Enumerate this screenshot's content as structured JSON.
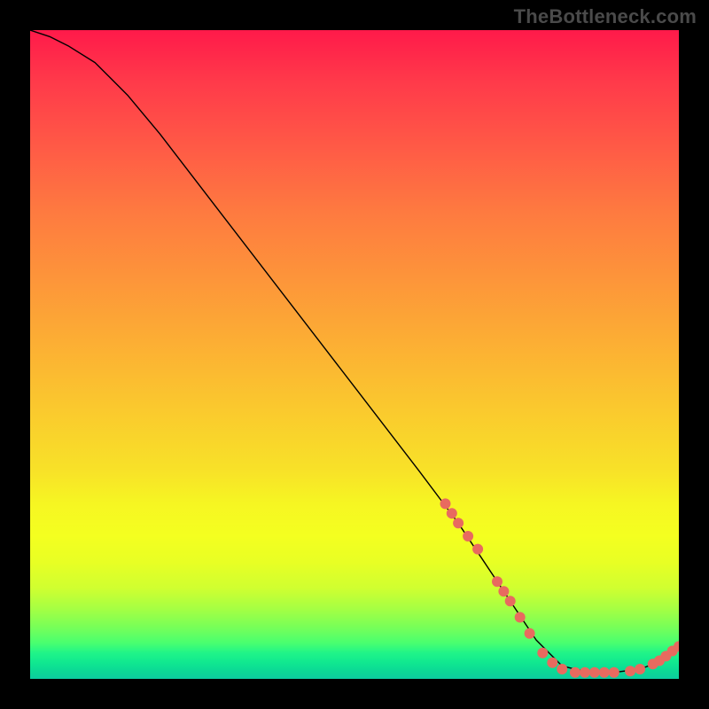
{
  "watermark": "TheBottleneck.com",
  "chart_data": {
    "type": "line",
    "title": "",
    "xlabel": "",
    "ylabel": "",
    "xlim": [
      0,
      100
    ],
    "ylim": [
      0,
      100
    ],
    "grid": false,
    "series": [
      {
        "name": "curve",
        "x": [
          0,
          3,
          6,
          10,
          15,
          20,
          30,
          40,
          50,
          60,
          66,
          70,
          74,
          78,
          82,
          86,
          90,
          94,
          98,
          100
        ],
        "y": [
          100,
          99,
          97.5,
          95,
          90,
          84,
          71,
          58,
          45,
          32,
          24,
          18,
          12,
          6,
          2,
          1,
          1,
          1.5,
          3,
          5
        ]
      }
    ],
    "markers": [
      {
        "x": 64,
        "y": 27
      },
      {
        "x": 65,
        "y": 25.5
      },
      {
        "x": 66,
        "y": 24
      },
      {
        "x": 67.5,
        "y": 22
      },
      {
        "x": 69,
        "y": 20
      },
      {
        "x": 72,
        "y": 15
      },
      {
        "x": 73,
        "y": 13.5
      },
      {
        "x": 74,
        "y": 12
      },
      {
        "x": 75.5,
        "y": 9.5
      },
      {
        "x": 77,
        "y": 7
      },
      {
        "x": 79,
        "y": 4
      },
      {
        "x": 80.5,
        "y": 2.5
      },
      {
        "x": 82,
        "y": 1.5
      },
      {
        "x": 84,
        "y": 1
      },
      {
        "x": 85.5,
        "y": 1
      },
      {
        "x": 87,
        "y": 1
      },
      {
        "x": 88.5,
        "y": 1
      },
      {
        "x": 90,
        "y": 1
      },
      {
        "x": 92.5,
        "y": 1.2
      },
      {
        "x": 94,
        "y": 1.5
      },
      {
        "x": 96,
        "y": 2.3
      },
      {
        "x": 97,
        "y": 2.8
      },
      {
        "x": 98,
        "y": 3.5
      },
      {
        "x": 99,
        "y": 4.3
      },
      {
        "x": 100,
        "y": 5
      }
    ],
    "colors": {
      "line": "#000000",
      "marker": "#e86a5f",
      "gradient_top": "#ff1a4a",
      "gradient_bottom": "#0ccca0"
    }
  }
}
